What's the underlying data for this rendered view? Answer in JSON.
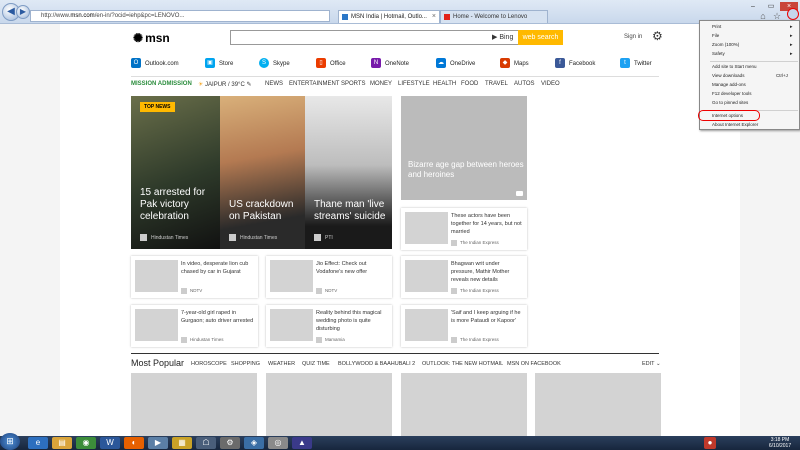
{
  "browser": {
    "address_prefix": "http://www.",
    "address_domain": "msn.com",
    "address_rest": "/en-in/?ocid=iehp&pc=LENOVO...",
    "tabs": [
      {
        "label": "MSN India | Hotmail, Outlo..."
      },
      {
        "label": "Home - Welcome to Lenovo"
      }
    ]
  },
  "msn": {
    "logo": "msn",
    "search_placeholder": "",
    "bing": "Bing",
    "search_btn": "web search",
    "signin": "Sign in"
  },
  "services": [
    {
      "label": "Outlook.com",
      "color": "#0072c6"
    },
    {
      "label": "Store",
      "color": "#00a4ef"
    },
    {
      "label": "Skype",
      "color": "#00aff0"
    },
    {
      "label": "Office",
      "color": "#eb3c00"
    },
    {
      "label": "OneNote",
      "color": "#7719aa"
    },
    {
      "label": "OneDrive",
      "color": "#0078d7"
    },
    {
      "label": "Maps",
      "color": "#d83b01"
    },
    {
      "label": "Facebook",
      "color": "#3b5998"
    },
    {
      "label": "Twitter",
      "color": "#1da1f2"
    }
  ],
  "nav": {
    "mission": "MISSION ADMISSION",
    "weather": "JAIPUR / 39°C",
    "items": [
      "NEWS",
      "ENTERTAINMENT",
      "SPORTS",
      "MONEY",
      "LIFESTYLE",
      "HEALTH",
      "FOOD",
      "TRAVEL",
      "AUTOS",
      "VIDEO"
    ]
  },
  "hero": {
    "badge": "TOP NEWS",
    "stories": [
      {
        "title": "15 arrested for Pak victory celebration",
        "source": "Hindustan Times"
      },
      {
        "title": "US crackdown on Pakistan",
        "source": "Hindustan Times"
      },
      {
        "title": "Thane man 'live streams' suicide",
        "source": "PTI"
      }
    ],
    "featured": "Bizarre age gap between heroes and heroines"
  },
  "cards": [
    {
      "text": "These actors have been together for 14 years, but not married",
      "source": "The Indian Express"
    },
    {
      "text": "In video, desperate lion cub chased by car in Gujarat",
      "source": "NDTV"
    },
    {
      "text": "Jio Effect: Check out Vodafone's new offer",
      "source": "NDTV"
    },
    {
      "text": "Bhagwan writ under pressure, Mathir Mother reveals new details",
      "source": "The Indian Express"
    },
    {
      "text": "7-year-old girl raped in Gurgaon; auto driver arrested",
      "source": "Hindustan Times"
    },
    {
      "text": "Reality behind this magical wedding photo is quite disturbing",
      "source": "Mamamia"
    },
    {
      "text": "'Saif and I keep arguing if he is more Pataudi or Kapoor'",
      "source": "The Indian Express"
    }
  ],
  "popular": {
    "title": "Most Popular",
    "links": [
      "HOROSCOPE",
      "SHOPPING",
      "WEATHER",
      "QUIZ TIME",
      "BOLLYWOOD & BAAHUBALI 2",
      "OUTLOOK: THE NEW HOTMAIL",
      "MSN ON FACEBOOK"
    ],
    "edit": "EDIT"
  },
  "menu": {
    "group1": [
      "Print",
      "File",
      "Zoom (100%)",
      "Safety"
    ],
    "group1_sub": [
      true,
      true,
      true,
      true
    ],
    "group2": [
      "Add site to Start menu",
      "View downloads",
      "Manage add-ons",
      "F12 developer tools",
      "Go to pinned sites"
    ],
    "downloads_shortcut": "Ctrl+J",
    "group3": [
      "Internet options",
      "About Internet Explorer"
    ]
  },
  "taskbar": {
    "time": "3:18 PM",
    "date": "6/10/2017"
  }
}
